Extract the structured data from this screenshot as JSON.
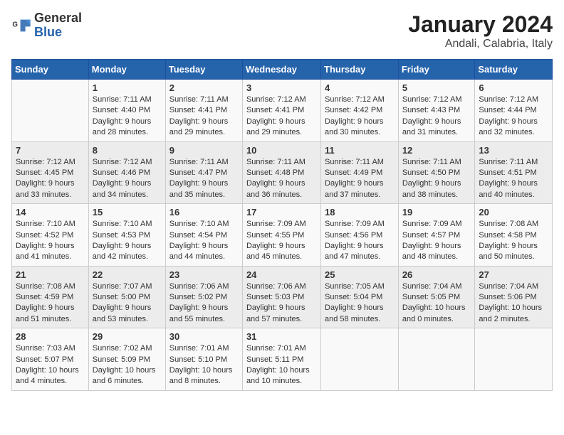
{
  "header": {
    "logo_general": "General",
    "logo_blue": "Blue",
    "title": "January 2024",
    "subtitle": "Andali, Calabria, Italy"
  },
  "weekdays": [
    "Sunday",
    "Monday",
    "Tuesday",
    "Wednesday",
    "Thursday",
    "Friday",
    "Saturday"
  ],
  "weeks": [
    [
      {
        "day": "",
        "info": ""
      },
      {
        "day": "1",
        "info": "Sunrise: 7:11 AM\nSunset: 4:40 PM\nDaylight: 9 hours\nand 28 minutes."
      },
      {
        "day": "2",
        "info": "Sunrise: 7:11 AM\nSunset: 4:41 PM\nDaylight: 9 hours\nand 29 minutes."
      },
      {
        "day": "3",
        "info": "Sunrise: 7:12 AM\nSunset: 4:41 PM\nDaylight: 9 hours\nand 29 minutes."
      },
      {
        "day": "4",
        "info": "Sunrise: 7:12 AM\nSunset: 4:42 PM\nDaylight: 9 hours\nand 30 minutes."
      },
      {
        "day": "5",
        "info": "Sunrise: 7:12 AM\nSunset: 4:43 PM\nDaylight: 9 hours\nand 31 minutes."
      },
      {
        "day": "6",
        "info": "Sunrise: 7:12 AM\nSunset: 4:44 PM\nDaylight: 9 hours\nand 32 minutes."
      }
    ],
    [
      {
        "day": "7",
        "info": "Sunrise: 7:12 AM\nSunset: 4:45 PM\nDaylight: 9 hours\nand 33 minutes."
      },
      {
        "day": "8",
        "info": "Sunrise: 7:12 AM\nSunset: 4:46 PM\nDaylight: 9 hours\nand 34 minutes."
      },
      {
        "day": "9",
        "info": "Sunrise: 7:11 AM\nSunset: 4:47 PM\nDaylight: 9 hours\nand 35 minutes."
      },
      {
        "day": "10",
        "info": "Sunrise: 7:11 AM\nSunset: 4:48 PM\nDaylight: 9 hours\nand 36 minutes."
      },
      {
        "day": "11",
        "info": "Sunrise: 7:11 AM\nSunset: 4:49 PM\nDaylight: 9 hours\nand 37 minutes."
      },
      {
        "day": "12",
        "info": "Sunrise: 7:11 AM\nSunset: 4:50 PM\nDaylight: 9 hours\nand 38 minutes."
      },
      {
        "day": "13",
        "info": "Sunrise: 7:11 AM\nSunset: 4:51 PM\nDaylight: 9 hours\nand 40 minutes."
      }
    ],
    [
      {
        "day": "14",
        "info": "Sunrise: 7:10 AM\nSunset: 4:52 PM\nDaylight: 9 hours\nand 41 minutes."
      },
      {
        "day": "15",
        "info": "Sunrise: 7:10 AM\nSunset: 4:53 PM\nDaylight: 9 hours\nand 42 minutes."
      },
      {
        "day": "16",
        "info": "Sunrise: 7:10 AM\nSunset: 4:54 PM\nDaylight: 9 hours\nand 44 minutes."
      },
      {
        "day": "17",
        "info": "Sunrise: 7:09 AM\nSunset: 4:55 PM\nDaylight: 9 hours\nand 45 minutes."
      },
      {
        "day": "18",
        "info": "Sunrise: 7:09 AM\nSunset: 4:56 PM\nDaylight: 9 hours\nand 47 minutes."
      },
      {
        "day": "19",
        "info": "Sunrise: 7:09 AM\nSunset: 4:57 PM\nDaylight: 9 hours\nand 48 minutes."
      },
      {
        "day": "20",
        "info": "Sunrise: 7:08 AM\nSunset: 4:58 PM\nDaylight: 9 hours\nand 50 minutes."
      }
    ],
    [
      {
        "day": "21",
        "info": "Sunrise: 7:08 AM\nSunset: 4:59 PM\nDaylight: 9 hours\nand 51 minutes."
      },
      {
        "day": "22",
        "info": "Sunrise: 7:07 AM\nSunset: 5:00 PM\nDaylight: 9 hours\nand 53 minutes."
      },
      {
        "day": "23",
        "info": "Sunrise: 7:06 AM\nSunset: 5:02 PM\nDaylight: 9 hours\nand 55 minutes."
      },
      {
        "day": "24",
        "info": "Sunrise: 7:06 AM\nSunset: 5:03 PM\nDaylight: 9 hours\nand 57 minutes."
      },
      {
        "day": "25",
        "info": "Sunrise: 7:05 AM\nSunset: 5:04 PM\nDaylight: 9 hours\nand 58 minutes."
      },
      {
        "day": "26",
        "info": "Sunrise: 7:04 AM\nSunset: 5:05 PM\nDaylight: 10 hours\nand 0 minutes."
      },
      {
        "day": "27",
        "info": "Sunrise: 7:04 AM\nSunset: 5:06 PM\nDaylight: 10 hours\nand 2 minutes."
      }
    ],
    [
      {
        "day": "28",
        "info": "Sunrise: 7:03 AM\nSunset: 5:07 PM\nDaylight: 10 hours\nand 4 minutes."
      },
      {
        "day": "29",
        "info": "Sunrise: 7:02 AM\nSunset: 5:09 PM\nDaylight: 10 hours\nand 6 minutes."
      },
      {
        "day": "30",
        "info": "Sunrise: 7:01 AM\nSunset: 5:10 PM\nDaylight: 10 hours\nand 8 minutes."
      },
      {
        "day": "31",
        "info": "Sunrise: 7:01 AM\nSunset: 5:11 PM\nDaylight: 10 hours\nand 10 minutes."
      },
      {
        "day": "",
        "info": ""
      },
      {
        "day": "",
        "info": ""
      },
      {
        "day": "",
        "info": ""
      }
    ]
  ]
}
